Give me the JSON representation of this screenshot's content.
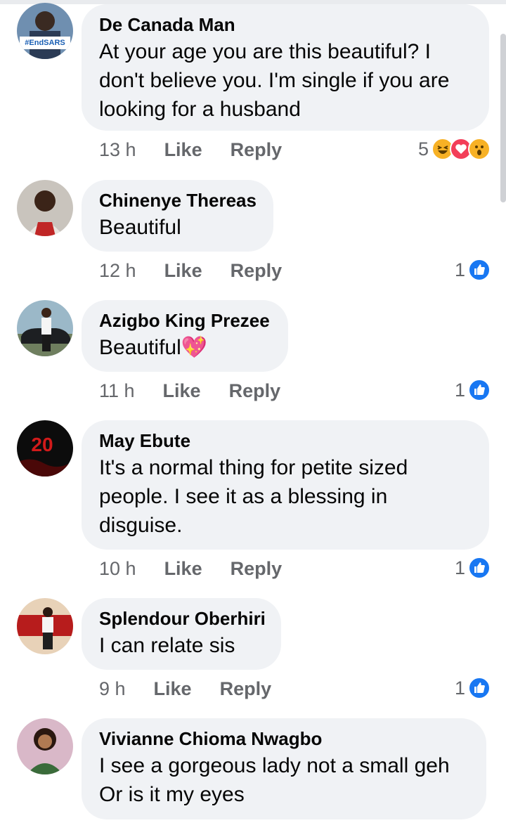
{
  "comments": [
    {
      "name": "De Canada Man",
      "text": "At your age you are this beautiful? I don't believe you. I'm single if you are looking for a husband",
      "time": "13 h",
      "like": "Like",
      "reply": "Reply",
      "reaction_count": "5",
      "reactions": [
        "haha-icon",
        "love-icon",
        "wow-icon"
      ],
      "avatar_badge": "#EndSARS"
    },
    {
      "name": "Chinenye Thereas",
      "text": "Beautiful",
      "time": "12 h",
      "like": "Like",
      "reply": "Reply",
      "reaction_count": "1",
      "reactions": [
        "like-icon"
      ]
    },
    {
      "name": "Azigbo King Prezee",
      "text": "Beautiful💖",
      "time": "11 h",
      "like": "Like",
      "reply": "Reply",
      "reaction_count": "1",
      "reactions": [
        "like-icon"
      ]
    },
    {
      "name": "May Ebute",
      "text": "It's a normal thing for petite sized people. I see it as a blessing in disguise.",
      "time": "10 h",
      "like": "Like",
      "reply": "Reply",
      "reaction_count": "1",
      "reactions": [
        "like-icon"
      ],
      "avatar_badge": "20"
    },
    {
      "name": "Splendour Oberhiri",
      "text": "I can relate sis",
      "time": "9 h",
      "like": "Like",
      "reply": "Reply",
      "reaction_count": "1",
      "reactions": [
        "like-icon"
      ]
    },
    {
      "name": "Vivianne Chioma Nwagbo",
      "text": "I see a gorgeous lady not a small geh Or is it my eyes"
    }
  ],
  "colors": {
    "bubble": "#f0f2f5",
    "meta": "#65676b",
    "like_blue": "#1877f2"
  }
}
